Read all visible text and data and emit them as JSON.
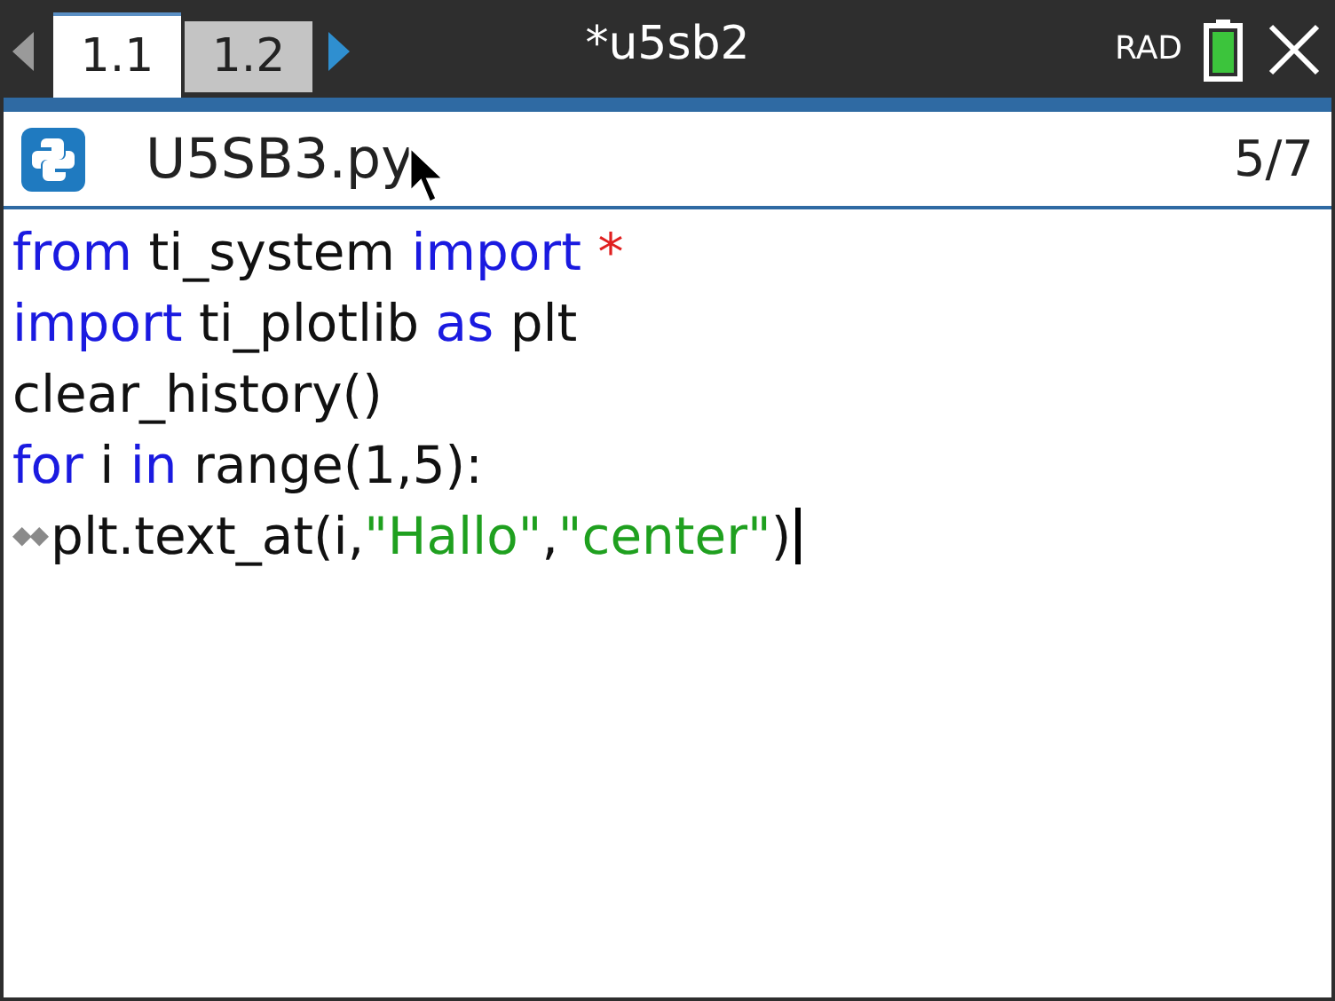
{
  "tabs": [
    {
      "label": "1.1",
      "selected": true
    },
    {
      "label": "1.2",
      "selected": false
    }
  ],
  "document_title": "*u5sb2",
  "angle_mode": "RAD",
  "editor": {
    "file_name": "U5SB3.py",
    "line_position": "5/7",
    "lines": [
      {
        "tokens": [
          {
            "kind": "keyword",
            "text": "from"
          },
          {
            "kind": "plain",
            "text": " ti_system "
          },
          {
            "kind": "keyword",
            "text": "import"
          },
          {
            "kind": "operator",
            "text": " *"
          }
        ]
      },
      {
        "tokens": [
          {
            "kind": "keyword",
            "text": "import"
          },
          {
            "kind": "plain",
            "text": " ti_plotlib "
          },
          {
            "kind": "keyword",
            "text": "as"
          },
          {
            "kind": "plain",
            "text": " plt"
          }
        ]
      },
      {
        "tokens": [
          {
            "kind": "plain",
            "text": "clear_history()"
          }
        ]
      },
      {
        "tokens": [
          {
            "kind": "keyword",
            "text": "for"
          },
          {
            "kind": "plain",
            "text": " i "
          },
          {
            "kind": "keyword",
            "text": "in"
          },
          {
            "kind": "plain",
            "text": " range(1,5):"
          }
        ]
      },
      {
        "cursor": true,
        "tokens": [
          {
            "kind": "indent",
            "text": "◆◆"
          },
          {
            "kind": "plain",
            "text": "plt.text_at(i,"
          },
          {
            "kind": "string",
            "text": "\"Hallo\""
          },
          {
            "kind": "plain",
            "text": ","
          },
          {
            "kind": "string",
            "text": "\"center\""
          },
          {
            "kind": "plain",
            "text": ")"
          }
        ]
      }
    ]
  }
}
